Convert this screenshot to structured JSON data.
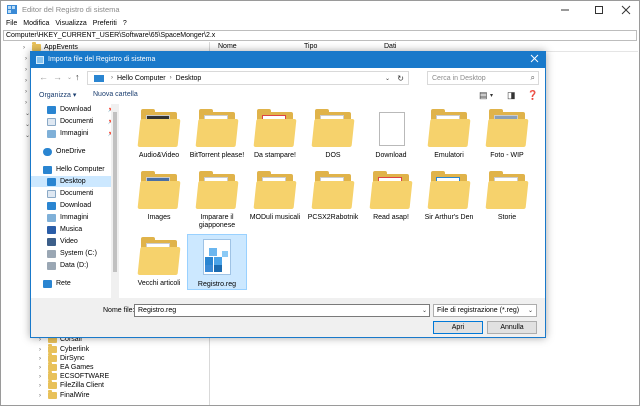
{
  "regedit": {
    "title": "Editor del Registro di sistema",
    "menu": [
      "File",
      "Modifica",
      "Visualizza",
      "Preferiti",
      "?"
    ],
    "address": "Computer\\HKEY_CURRENT_USER\\Software\\65\\SpaceMonger\\2.x",
    "columns": [
      "Nome",
      "Tipo",
      "Dati"
    ],
    "tree_top": [
      "AppEvents"
    ],
    "tree_bottom": [
      "Corsair",
      "Cyberlink",
      "DirSync",
      "EA Games",
      "ECSOFTWARE",
      "FileZilla Client",
      "FinalWire"
    ]
  },
  "dialog": {
    "title": "Importa file del Registro di sistema",
    "breadcrumb": [
      "Hello Computer",
      "Desktop"
    ],
    "search_placeholder": "Cerca in Desktop",
    "organize_label": "Organizza ▾",
    "new_folder_label": "Nuova cartella",
    "nav_items": [
      {
        "label": "Download",
        "icon": "download-icon",
        "pinned": true
      },
      {
        "label": "Documenti",
        "icon": "documents-icon",
        "pinned": true
      },
      {
        "label": "Immagini",
        "icon": "pictures-icon",
        "pinned": true
      },
      {
        "label": "OneDrive",
        "icon": "onedrive-icon",
        "pinned": false
      },
      {
        "label": "Hello Computer",
        "icon": "computer-icon",
        "pinned": false
      },
      {
        "label": "Desktop",
        "icon": "desktop-icon",
        "pinned": false,
        "selected": true
      },
      {
        "label": "Documenti",
        "icon": "documents-icon",
        "pinned": false
      },
      {
        "label": "Download",
        "icon": "download-icon",
        "pinned": false
      },
      {
        "label": "Immagini",
        "icon": "pictures-icon",
        "pinned": false
      },
      {
        "label": "Musica",
        "icon": "music-icon",
        "pinned": false
      },
      {
        "label": "Video",
        "icon": "video-icon",
        "pinned": false
      },
      {
        "label": "System (C:)",
        "icon": "drive-icon",
        "pinned": false
      },
      {
        "label": "Data (D:)",
        "icon": "drive-icon",
        "pinned": false
      },
      {
        "label": "Rete",
        "icon": "network-icon",
        "pinned": false
      }
    ],
    "files": [
      {
        "label": "Audio&Video",
        "kind": "folder"
      },
      {
        "label": "BitTorrent please!",
        "kind": "folder"
      },
      {
        "label": "Da stampare!",
        "kind": "folder"
      },
      {
        "label": "DOS",
        "kind": "folder"
      },
      {
        "label": "Download",
        "kind": "folder"
      },
      {
        "label": "Emulatori",
        "kind": "folder"
      },
      {
        "label": "Foto - WIP",
        "kind": "folder"
      },
      {
        "label": "Images",
        "kind": "folder"
      },
      {
        "label": "Imparare il giapponese",
        "kind": "folder"
      },
      {
        "label": "MODuli musicali",
        "kind": "folder"
      },
      {
        "label": "PCSX2Rabotnik",
        "kind": "folder"
      },
      {
        "label": "Read asap!",
        "kind": "folder"
      },
      {
        "label": "Sir Arthur's Den",
        "kind": "folder"
      },
      {
        "label": "Storie",
        "kind": "folder"
      },
      {
        "label": "Vecchi articoli",
        "kind": "folder"
      },
      {
        "label": "Registro.reg",
        "kind": "reg",
        "selected": true
      }
    ],
    "filename_label": "Nome file:",
    "filename_value": "Registro.reg",
    "filetype_value": "File di registrazione (*.reg)",
    "open_label": "Apri",
    "cancel_label": "Annulla"
  },
  "colors": {
    "accent": "#1979ca",
    "selection": "#cce8ff",
    "folder": "#f6d26c"
  }
}
